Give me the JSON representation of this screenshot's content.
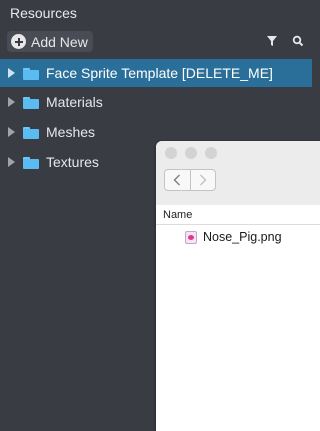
{
  "panel": {
    "title": "Resources"
  },
  "toolbar": {
    "add_label": "Add New",
    "filter_icon": "filter-icon",
    "search_icon": "search-icon"
  },
  "tree": {
    "items": [
      {
        "label": "Face Sprite Template [DELETE_ME]",
        "selected": true
      },
      {
        "label": "Materials",
        "selected": false
      },
      {
        "label": "Meshes",
        "selected": false
      },
      {
        "label": "Textures",
        "selected": false
      }
    ]
  },
  "dialog": {
    "column_name": "Name",
    "files": [
      {
        "name": "Nose_Pig.png"
      }
    ]
  },
  "colors": {
    "panel_bg": "#3a3c44",
    "selection": "#2a6f9a",
    "folder": "#5bbcf2"
  }
}
